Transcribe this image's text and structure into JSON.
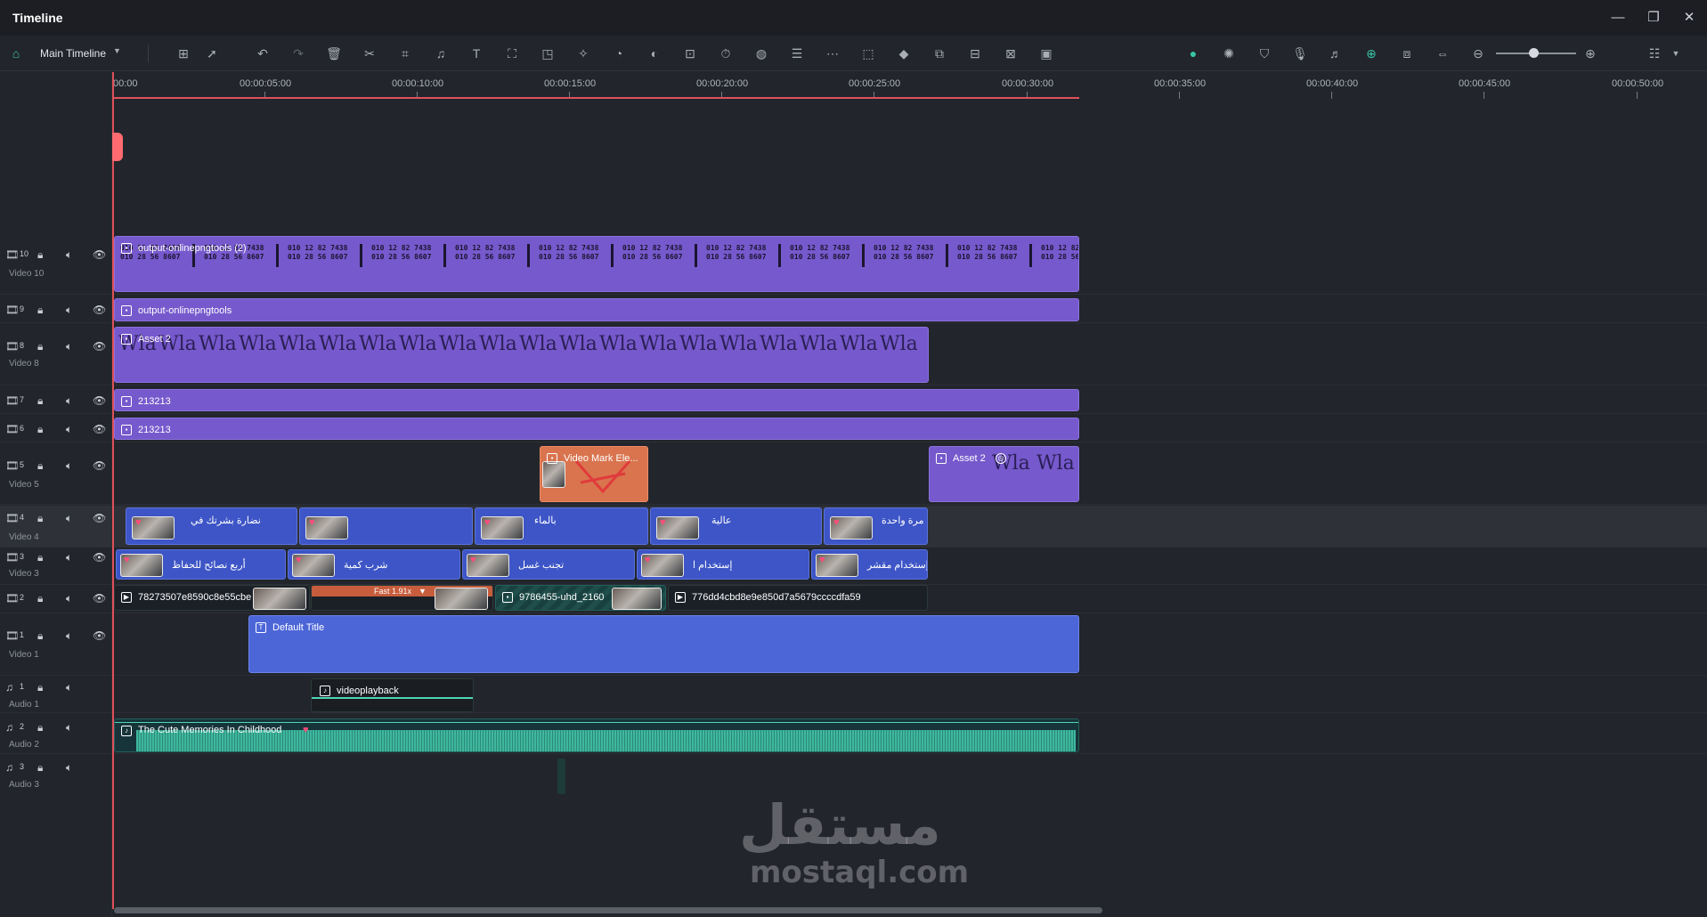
{
  "window": {
    "title": "Timeline"
  },
  "toolbar": {
    "timeline_selector": "Main Timeline"
  },
  "ruler": {
    "ticks": [
      "00:00",
      "00:00:05:00",
      "00:00:10:00",
      "00:00:15:00",
      "00:00:20:00",
      "00:00:25:00",
      "00:00:30:00",
      "00:00:35:00",
      "00:00:40:00",
      "00:00:45:00",
      "00:00:50:00"
    ]
  },
  "tracks": [
    {
      "num": "10",
      "name": "Video 10"
    },
    {
      "num": "9",
      "name": ""
    },
    {
      "num": "8",
      "name": "Video 8"
    },
    {
      "num": "7",
      "name": ""
    },
    {
      "num": "6",
      "name": ""
    },
    {
      "num": "5",
      "name": "Video 5"
    },
    {
      "num": "4",
      "name": "Video 4"
    },
    {
      "num": "3",
      "name": "Video 3"
    },
    {
      "num": "2",
      "name": ""
    },
    {
      "num": "1",
      "name": "Video 1"
    },
    {
      "num": "1",
      "name": "Audio 1"
    },
    {
      "num": "2",
      "name": "Audio 2"
    },
    {
      "num": "3",
      "name": "Audio 3"
    }
  ],
  "clips": {
    "v10": "output-onlinepngtools (2)",
    "v10_phone_1": "010 12 82 7438",
    "v10_phone_2": "010 28 56 8607",
    "v9": "output-onlinepngtools",
    "v8": "Asset 2",
    "v8_wla": "Wla",
    "v7": "213213",
    "v6": "213213",
    "v5_a": "Video Mark Ele...",
    "v5_b": "Asset 2",
    "v4": [
      "نضارة بشرتك في",
      "",
      "بالماء",
      "عالية",
      "مرة واحدة"
    ],
    "v3": [
      "أربع نصائح للحفاظ",
      "شرب كمية",
      "تجنب غسل",
      "إستخدام ا",
      "إستخدام مقشر"
    ],
    "v2_a": "78273507e8590c8e55cbe",
    "v2_fast": "Fast 1.91x",
    "v2_b": "9786455-uhd_2160",
    "v2_c": "776dd4cbd8e9e850d7a5679ccccdfa59",
    "v1": "Default Title",
    "a1": "videoplayback",
    "a2": "The Cute Memories In Childhood"
  },
  "watermark": {
    "ar": "مستقل",
    "en": "mostaql.com"
  }
}
